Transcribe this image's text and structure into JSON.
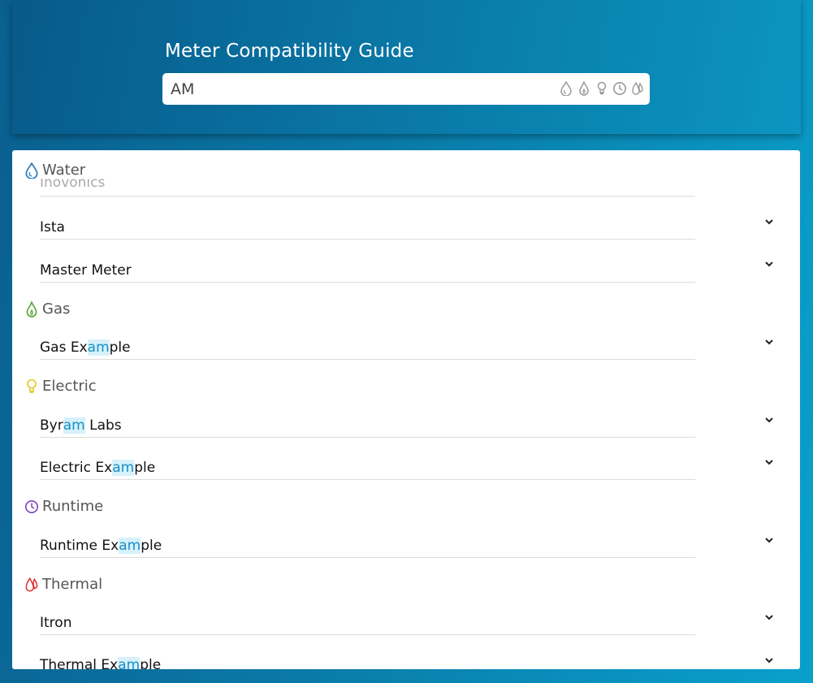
{
  "header": {
    "title": "Meter Compatibility Guide",
    "search_value": "AM",
    "filter_icons": [
      "water-icon",
      "gas-icon",
      "electric-icon",
      "runtime-icon",
      "thermal-icon"
    ]
  },
  "colors": {
    "water": "#2f7fc0",
    "gas": "#5aa83a",
    "electric": "#e2cc2a",
    "runtime": "#7b3fbf",
    "thermal": "#e0323a",
    "highlight_bg": "#d6f1fb",
    "highlight_fg": "#1a8fc2"
  },
  "categories": [
    {
      "name": "Water",
      "icon": "water-icon",
      "items": [
        {
          "pre": "Inovonics",
          "hl": "",
          "post": ""
        },
        {
          "pre": "Ista",
          "hl": "",
          "post": ""
        },
        {
          "pre": "Master Meter",
          "hl": "",
          "post": ""
        }
      ]
    },
    {
      "name": "Gas",
      "icon": "gas-icon",
      "items": [
        {
          "pre": "Gas Ex",
          "hl": "am",
          "post": "ple"
        }
      ]
    },
    {
      "name": "Electric",
      "icon": "electric-icon",
      "items": [
        {
          "pre": "Byr",
          "hl": "am",
          "post": " Labs"
        },
        {
          "pre": "Electric Ex",
          "hl": "am",
          "post": "ple"
        }
      ]
    },
    {
      "name": "Runtime",
      "icon": "runtime-icon",
      "items": [
        {
          "pre": "Runtime Ex",
          "hl": "am",
          "post": "ple"
        }
      ]
    },
    {
      "name": "Thermal",
      "icon": "thermal-icon",
      "items": [
        {
          "pre": "Itron",
          "hl": "",
          "post": ""
        },
        {
          "pre": "Thermal Ex",
          "hl": "am",
          "post": "ple"
        }
      ]
    }
  ]
}
